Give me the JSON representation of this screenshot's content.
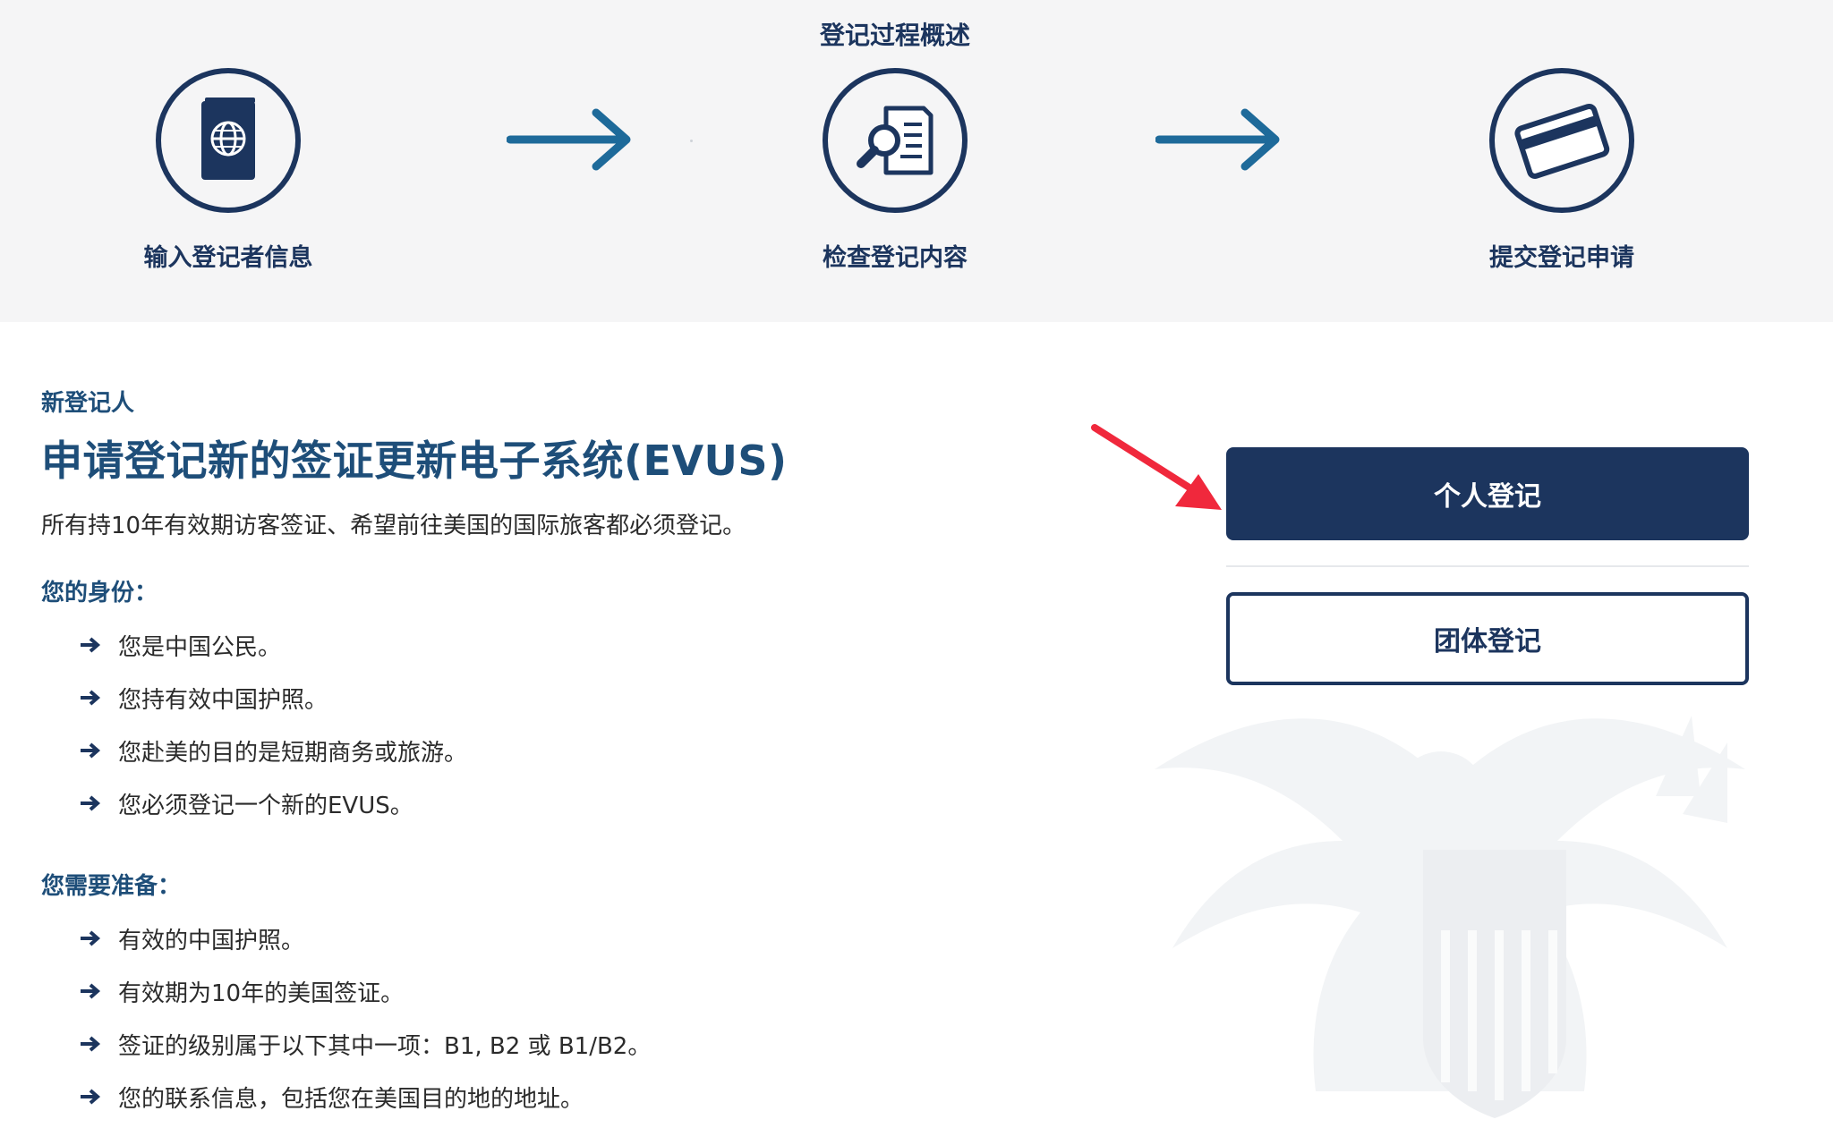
{
  "process": {
    "title": "登记过程概述",
    "steps": [
      {
        "label": "输入登记者信息",
        "icon": "passport-icon"
      },
      {
        "label": "检查登记内容",
        "icon": "document-search-icon"
      },
      {
        "label": "提交登记申请",
        "icon": "credit-card-icon"
      }
    ]
  },
  "main": {
    "eyebrow": "新登记人",
    "headline": "申请登记新的签证更新电子系统(EVUS)",
    "lead": "所有持10年有效期访客签证、希望前往美国的国际旅客都必须登记。",
    "identity": {
      "title": "您的身份：",
      "items": [
        "您是中国公民。",
        "您持有效中国护照。",
        "您赴美的目的是短期商务或旅游。",
        "您必须登记一个新的EVUS。"
      ]
    },
    "prepare": {
      "title": "您需要准备：",
      "items": [
        "有效的中国护照。",
        "有效期为10年的美国签证。",
        "签证的级别属于以下其中一项：B1, B2 或 B1/B2。",
        "您的联系信息，包括您在美国目的地的地址。"
      ]
    }
  },
  "actions": {
    "individual_label": "个人登记",
    "group_label": "团体登记"
  },
  "colors": {
    "navy": "#1c355e",
    "heading_blue": "#1e4e79",
    "flow_arrow": "#1e6a9a",
    "annotation_red": "#f0283c",
    "band_bg": "#f5f5f6"
  }
}
